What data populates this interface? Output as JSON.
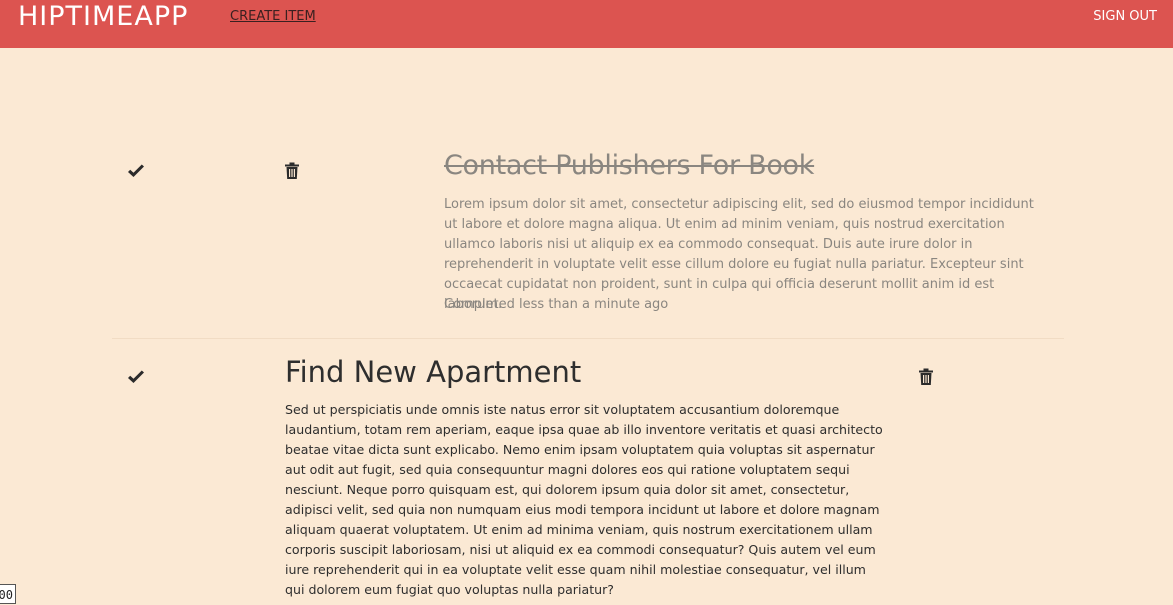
{
  "navbar": {
    "brand": "HIPTIMEAPP",
    "create_item": "CREATE ITEM",
    "sign_out": "SIGN OUT"
  },
  "items": [
    {
      "title": "Contact Publishers For Book",
      "description": "Lorem ipsum dolor sit amet, consectetur adipiscing elit, sed do eiusmod tempor incididunt ut labore et dolore magna aliqua. Ut enim ad minim veniam, quis nostrud exercitation ullamco laboris nisi ut aliquip ex ea commodo consequat. Duis aute irure dolor in reprehenderit in voluptate velit esse cillum dolore eu fugiat nulla pariatur. Excepteur sint occaecat cupidatat non proident, sunt in culpa qui officia deserunt mollit anim id est laborum.",
      "status": "Completed less than a minute ago",
      "completed": true
    },
    {
      "title": "Find New Apartment",
      "description": "Sed ut perspiciatis unde omnis iste natus error sit voluptatem accusantium doloremque laudantium, totam rem aperiam, eaque ipsa quae ab illo inventore veritatis et quasi architecto beatae vitae dicta sunt explicabo. Nemo enim ipsam voluptatem quia voluptas sit aspernatur aut odit aut fugit, sed quia consequuntur magni dolores eos qui ratione voluptatem sequi nesciunt. Neque porro quisquam est, qui dolorem ipsum quia dolor sit amet, consectetur, adipisci velit, sed quia non numquam eius modi tempora incidunt ut labore et dolore magnam aliquam quaerat voluptatem. Ut enim ad minima veniam, quis nostrum exercitationem ullam corporis suscipit laboriosam, nisi ut aliquid ex ea commodi consequatur? Quis autem vel eum iure reprehenderit qui in ea voluptate velit esse quam nihil molestiae consequatur, vel illum qui dolorem eum fugiat quo voluptas nulla pariatur?",
      "completed": false
    }
  ],
  "corner_badge": "00",
  "colors": {
    "navbar_bg": "#dc5450",
    "page_bg": "#fbe9d4",
    "completed_text": "#8a8680"
  },
  "icons": [
    "check-icon",
    "trash-icon"
  ]
}
